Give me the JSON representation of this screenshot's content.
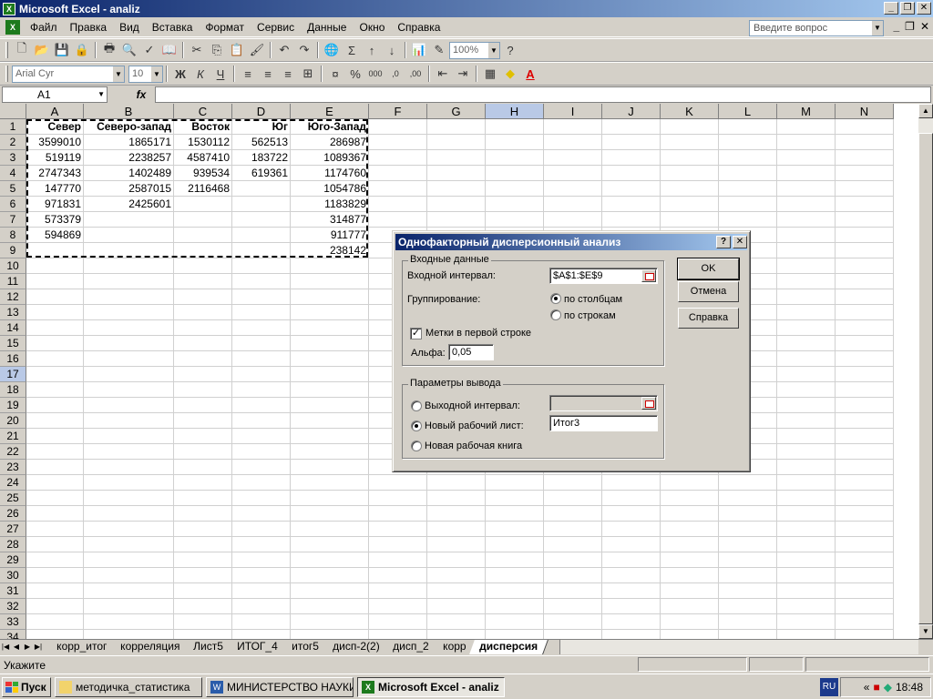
{
  "window": {
    "title": "Microsoft Excel - analiz"
  },
  "menu": [
    "Файл",
    "Правка",
    "Вид",
    "Вставка",
    "Формат",
    "Сервис",
    "Данные",
    "Окно",
    "Справка"
  ],
  "help_box": {
    "placeholder": "Введите вопрос"
  },
  "toolbar": {
    "zoom": "100%",
    "font": "Arial Cyr",
    "font_size": "10"
  },
  "formula_bar": {
    "name_box": "A1",
    "fx": "fx",
    "formula": ""
  },
  "columns": [
    "A",
    "B",
    "C",
    "D",
    "E",
    "F",
    "G",
    "H",
    "I",
    "J",
    "K",
    "L",
    "M",
    "N"
  ],
  "rows": [
    "1",
    "2",
    "3",
    "4",
    "5",
    "6",
    "7",
    "8",
    "9",
    "10",
    "11",
    "12",
    "13",
    "14",
    "15",
    "16",
    "17",
    "18",
    "19",
    "20",
    "21",
    "22",
    "23",
    "24",
    "25",
    "26",
    "27",
    "28",
    "29",
    "30",
    "31",
    "32",
    "33",
    "34"
  ],
  "sheet": {
    "headers": [
      "Север",
      "Северо-запад",
      "Восток",
      "Юг",
      "Юго-Запад"
    ],
    "data": [
      [
        "3599010",
        "1865171",
        "1530112",
        "562513",
        "286987"
      ],
      [
        "519119",
        "2238257",
        "4587410",
        "183722",
        "1089367"
      ],
      [
        "2747343",
        "1402489",
        "939534",
        "619361",
        "1174760"
      ],
      [
        "147770",
        "2587015",
        "2116468",
        "",
        "1054786"
      ],
      [
        "971831",
        "2425601",
        "",
        "",
        "1183829"
      ],
      [
        "573379",
        "",
        "",
        "",
        "314877"
      ],
      [
        "594869",
        "",
        "",
        "",
        "911777"
      ],
      [
        "",
        "",
        "",
        "",
        "238142"
      ]
    ]
  },
  "dialog": {
    "title": "Однофакторный дисперсионный анализ",
    "input_group": "Входные данные",
    "input_range_label": "Входной интервал:",
    "input_range": "$A$1:$E$9",
    "grouping_label": "Группирование:",
    "by_columns": "по столбцам",
    "by_rows": "по строкам",
    "labels_first_row": "Метки в первой строке",
    "alpha_label": "Альфа:",
    "alpha": "0,05",
    "output_group": "Параметры вывода",
    "output_range": "Выходной интервал:",
    "new_sheet": "Новый рабочий лист:",
    "new_sheet_value": "Итог3",
    "new_book": "Новая рабочая книга",
    "ok": "OK",
    "cancel": "Отмена",
    "help": "Справка"
  },
  "tabs": [
    "корр_итог",
    "корреляция",
    "Лист5",
    "ИТОГ_4",
    "итог5",
    "дисп-2(2)",
    "дисп_2",
    "корр",
    "дисперсия"
  ],
  "status": "Укажите",
  "taskbar": {
    "start": "Пуск",
    "tasks": [
      "методичка_статистика",
      "МИНИСТЕРСТВО НАУКИ...",
      "Microsoft Excel - analiz"
    ],
    "lang": "RU",
    "clock": "18:48"
  }
}
